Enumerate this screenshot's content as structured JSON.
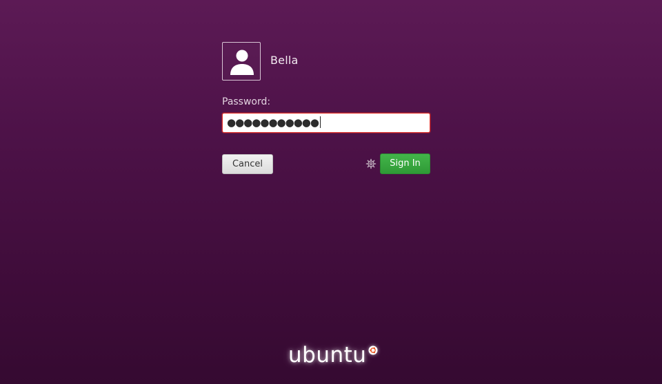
{
  "user": {
    "name": "Bella",
    "avatar_icon": "user-avatar-icon"
  },
  "password": {
    "label": "Password:",
    "value_masked": "●●●●●●●●●●●"
  },
  "buttons": {
    "cancel": "Cancel",
    "sign_in": "Sign In"
  },
  "session_icon": "gear-icon",
  "branding": {
    "logo_text": "ubuntu",
    "logo_icon": "ubuntu-circle-of-friends-icon"
  },
  "colors": {
    "background_top": "#5c1a55",
    "background_bottom": "#350a31",
    "sign_in_green": "#3aa941",
    "input_error_border": "#e0302a"
  }
}
